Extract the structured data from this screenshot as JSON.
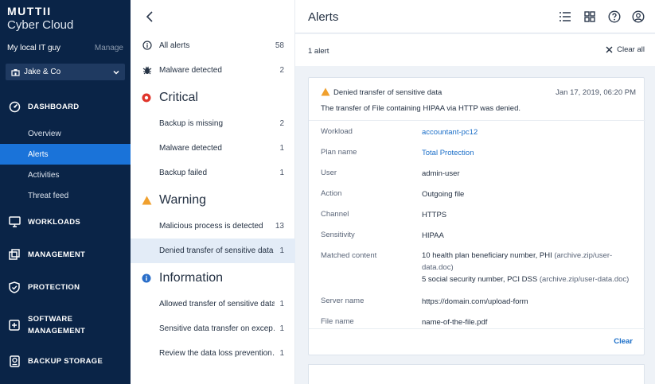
{
  "brand": {
    "line1": "MUTTII",
    "line2": "Cyber Cloud"
  },
  "account": {
    "name": "My local IT guy",
    "manage_label": "Manage"
  },
  "tenant": {
    "name": "Jake & Co"
  },
  "nav": {
    "dashboard": "DASHBOARD",
    "overview": "Overview",
    "alerts": "Alerts",
    "activities": "Activities",
    "threat_feed": "Threat feed",
    "workloads": "WORKLOADS",
    "management": "MANAGEMENT",
    "protection": "PROTECTION",
    "software_line1": "SOFTWARE",
    "software_line2": "MANAGEMENT",
    "backup_storage": "BACKUP STORAGE"
  },
  "middle": {
    "all_alerts": {
      "label": "All alerts",
      "count": "58"
    },
    "malware_top": {
      "label": "Malware detected",
      "count": "2"
    },
    "critical": "Critical",
    "backup_missing": {
      "label": "Backup is missing",
      "count": "2"
    },
    "malware_critical": {
      "label": "Malware detected",
      "count": "1"
    },
    "backup_failed": {
      "label": "Backup failed",
      "count": "1"
    },
    "warning": "Warning",
    "malicious_process": {
      "label": "Malicious process is detected",
      "count": "13"
    },
    "denied_transfer": {
      "label": "Denied transfer of sensitive data",
      "count": "1"
    },
    "information": "Information",
    "allowed_transfer": {
      "label": "Allowed transfer of sensitive data",
      "count": "1"
    },
    "sensitive_exception": {
      "label": "Sensitive data transfer on excep…",
      "count": "1"
    },
    "review_dlp": {
      "label": "Review the data loss prevention…",
      "count": "1"
    }
  },
  "header": {
    "title": "Alerts"
  },
  "alerts_bar": {
    "count_text": "1 alert",
    "clear_all": "Clear all"
  },
  "alert": {
    "title": "Denied transfer of sensitive data",
    "timestamp": "Jan 17, 2019, 06:20 PM",
    "description": "The transfer of File containing HIPAA via HTTP was denied.",
    "fields": {
      "workload": {
        "label": "Workload",
        "value": "accountant-pc12"
      },
      "plan": {
        "label": "Plan name",
        "value": "Total Protection"
      },
      "user": {
        "label": "User",
        "value": "admin-user"
      },
      "action": {
        "label": "Action",
        "value": "Outgoing file"
      },
      "channel": {
        "label": "Channel",
        "value": "HTTPS"
      },
      "sensitivity": {
        "label": "Sensitivity",
        "value": "HIPAA"
      },
      "matched": {
        "label": "Matched content",
        "line1": "10 health plan beneficiary number, PHI ",
        "line1_paren": "(archive.zip/user-",
        "line2_paren": "data.doc)",
        "line3": "5 social security number, PCI DSS ",
        "line3_paren": "(archive.zip/user-data.doc)"
      },
      "server": {
        "label": "Server name",
        "value": "https://domain.com/upload-form"
      },
      "file": {
        "label": "File name",
        "value": "name-of-the-file.pdf"
      }
    },
    "clear_label": "Clear"
  },
  "colors": {
    "sidebar": "#0a2447",
    "active": "#1a73d9",
    "link": "#1a6ec8",
    "warning": "#f0a02e",
    "critical": "#e0352b",
    "info": "#2a6ec9"
  }
}
